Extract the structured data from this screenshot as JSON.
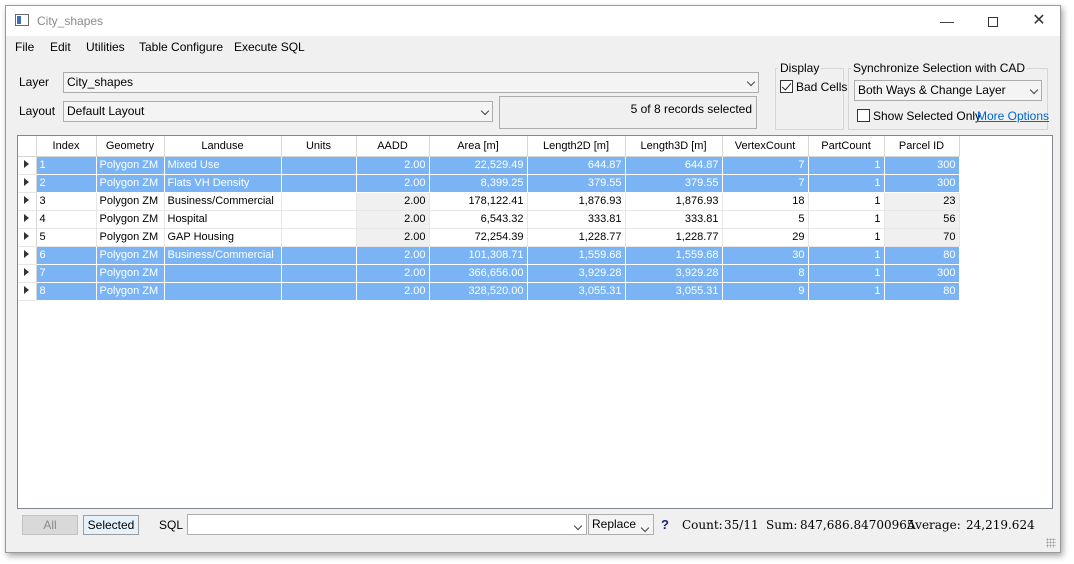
{
  "window": {
    "title": "City_shapes"
  },
  "menu": [
    "File",
    "Edit",
    "Utilities",
    "Table Configure",
    "Execute SQL"
  ],
  "layer": {
    "label": "Layer",
    "value": "City_shapes"
  },
  "layout": {
    "label": "Layout",
    "value": "Default Layout"
  },
  "status": "5 of 8 records selected",
  "display": {
    "title": "Display",
    "bad_cells_label": "Bad Cells",
    "bad_cells_checked": true
  },
  "sync": {
    "title": "Synchronize Selection with CAD",
    "mode": "Both Ways & Change Layer",
    "show_selected_only_label": "Show Selected Only",
    "show_selected_only_checked": false,
    "more_options_label": "More Options"
  },
  "table": {
    "columns": [
      "Index",
      "Geometry",
      "Landuse",
      "Units",
      "AADD",
      "Area [m]",
      "Length2D [m]",
      "Length3D [m]",
      "VertexCount",
      "PartCount",
      "Parcel ID"
    ],
    "rows": [
      {
        "selected": true,
        "cells": [
          "1",
          "Polygon ZM",
          "Mixed Use",
          "",
          "2.00",
          "22,529.49",
          "644.87",
          "644.87",
          "7",
          "1",
          "300"
        ]
      },
      {
        "selected": true,
        "cells": [
          "2",
          "Polygon ZM",
          "Flats VH Density",
          "",
          "2.00",
          "8,399.25",
          "379.55",
          "379.55",
          "7",
          "1",
          "300"
        ]
      },
      {
        "selected": false,
        "cells": [
          "3",
          "Polygon ZM",
          "Business/Commercial",
          "",
          "2.00",
          "178,122.41",
          "1,876.93",
          "1,876.93",
          "18",
          "1",
          "23"
        ]
      },
      {
        "selected": false,
        "cells": [
          "4",
          "Polygon ZM",
          "Hospital",
          "",
          "2.00",
          "6,543.32",
          "333.81",
          "333.81",
          "5",
          "1",
          "56"
        ]
      },
      {
        "selected": false,
        "cells": [
          "5",
          "Polygon ZM",
          "GAP Housing",
          "",
          "2.00",
          "72,254.39",
          "1,228.77",
          "1,228.77",
          "29",
          "1",
          "70"
        ]
      },
      {
        "selected": true,
        "cells": [
          "6",
          "Polygon ZM",
          "Business/Commercial",
          "",
          "2.00",
          "101,308.71",
          "1,559.68",
          "1,559.68",
          "30",
          "1",
          "80"
        ]
      },
      {
        "selected": true,
        "cells": [
          "7",
          "Polygon ZM",
          "",
          "",
          "2.00",
          "366,656.00",
          "3,929.28",
          "3,929.28",
          "8",
          "1",
          "300"
        ]
      },
      {
        "selected": true,
        "cells": [
          "8",
          "Polygon ZM",
          "",
          "",
          "2.00",
          "328,520.00",
          "3,055.31",
          "3,055.31",
          "9",
          "1",
          "80"
        ]
      }
    ]
  },
  "bottom": {
    "all_label": "All",
    "selected_label": "Selected",
    "sql_label": "SQL",
    "sql_value": "",
    "mode": "Replace",
    "help": "?",
    "count_label": "Count:",
    "count_value": "35/11",
    "sum_label": "Sum:",
    "sum_value": "847,686.84700965",
    "avg_label": "Average:",
    "avg_value": "24,219.624"
  }
}
